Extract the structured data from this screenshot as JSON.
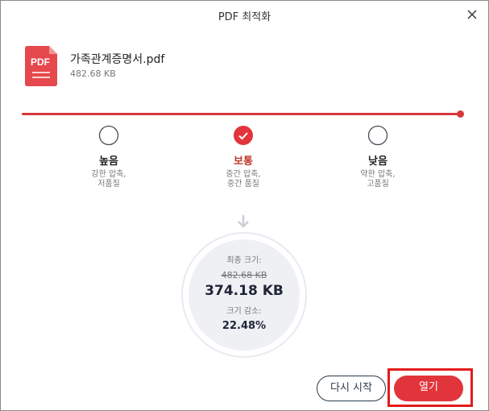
{
  "window": {
    "title": "PDF 최적화"
  },
  "file": {
    "icon_label": "PDF",
    "name": "가족관계증명서.pdf",
    "size": "482.68 KB"
  },
  "compression": {
    "selected": "보통",
    "options": [
      {
        "title": "높음",
        "desc_line1": "강한 압축,",
        "desc_line2": "저품질"
      },
      {
        "title": "보통",
        "desc_line1": "중간 압축,",
        "desc_line2": "중간 품질"
      },
      {
        "title": "낮음",
        "desc_line1": "약한 압축,",
        "desc_line2": "고품질"
      }
    ]
  },
  "result": {
    "final_size_label": "최종 크기:",
    "original_size": "482.68 KB",
    "new_size": "374.18 KB",
    "reduction_label": "크기 감소:",
    "reduction_percent": "22.48%"
  },
  "actions": {
    "restart_label": "다시 시작",
    "open_label": "열기"
  },
  "colors": {
    "accent": "#e2353b",
    "dark": "#2b3a4c",
    "highlight": "#e41b1b"
  }
}
